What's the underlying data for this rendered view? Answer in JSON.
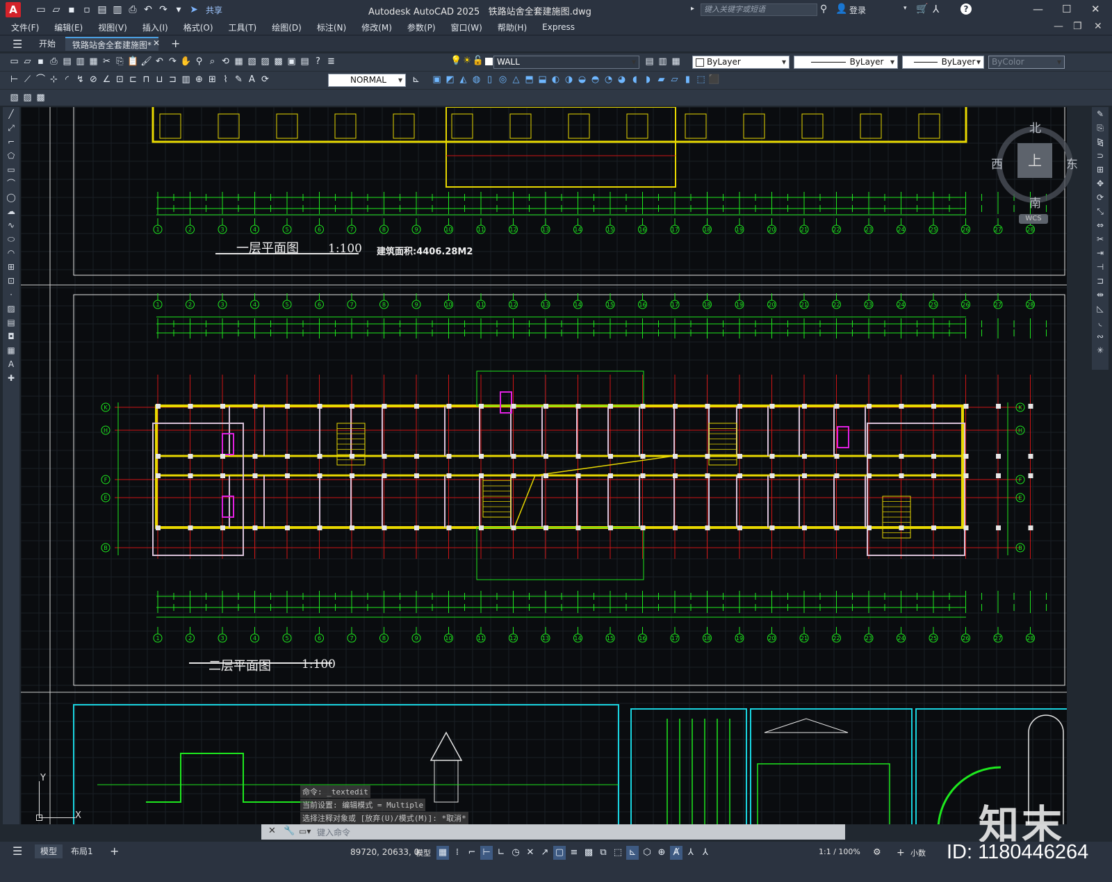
{
  "app": {
    "name": "Autodesk AutoCAD 2025",
    "file": "铁路站舍全套建施图.dwg",
    "share": "共享",
    "search_placeholder": "键入关键字或短语",
    "login": "登录"
  },
  "menu": [
    "文件(F)",
    "编辑(E)",
    "视图(V)",
    "插入(I)",
    "格式(O)",
    "工具(T)",
    "绘图(D)",
    "标注(N)",
    "修改(M)",
    "参数(P)",
    "窗口(W)",
    "帮助(H)",
    "Express"
  ],
  "tabs": {
    "start": "开始",
    "drawing": "铁路站舍全套建施图*",
    "add": "+"
  },
  "toolbars": {
    "layer": "WALL",
    "color": "ByLayer",
    "linetype": "ByLayer",
    "lineweight": "ByLayer",
    "plotstyle": "ByColor",
    "dimstyle": "NORMAL"
  },
  "viewcube": {
    "top": "上",
    "north": "北",
    "south": "南",
    "east": "东",
    "west": "西",
    "wcs": "WCS"
  },
  "drawing": {
    "plan1_title": "一层平面图",
    "plan1_scale": "1:100",
    "plan1_area": "建筑面积:4406.28M2",
    "plan2_title": "二层平面图",
    "plan2_scale": "1:100",
    "axis_numbers": [
      "1",
      "2",
      "3",
      "4",
      "5",
      "6",
      "7",
      "8",
      "9",
      "10",
      "11",
      "12",
      "13",
      "14",
      "15",
      "16",
      "17",
      "18",
      "19",
      "20",
      "21",
      "22",
      "23",
      "24",
      "25",
      "26",
      "27",
      "28"
    ],
    "row_labels": [
      "K",
      "H",
      "F",
      "E",
      "B"
    ]
  },
  "command": {
    "history": [
      "命令: _textedit",
      "当前设置: 编辑模式 = Multiple",
      "选择注释对象或 [放弃(U)/模式(M)]: *取消*"
    ],
    "input_placeholder": "键入命令"
  },
  "layout_tabs": {
    "model": "模型",
    "layout1": "布局1",
    "add": "+"
  },
  "status": {
    "coords": "89720, 20633, 0",
    "model": "模型",
    "scale": "1:1 / 100%",
    "units": "小数"
  },
  "watermark": {
    "brand": "知末",
    "id": "ID: 1180446264"
  },
  "colors": {
    "canvas_bg": "#0a0c0f",
    "dim_green": "#1ee81e",
    "wall_yellow": "#e8d800",
    "axis_red": "#d01515",
    "viewport_cyan": "#19d4e0"
  }
}
